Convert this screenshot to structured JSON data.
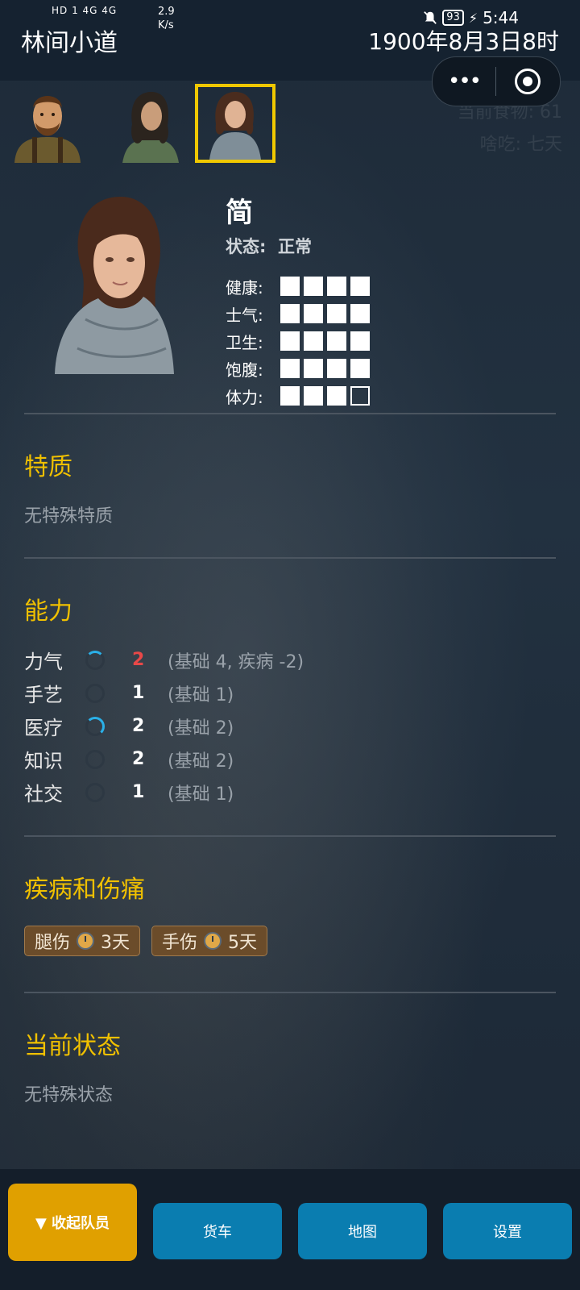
{
  "status_bar": {
    "left_icons": "HD 1  4G  4G",
    "net_speed": "2.9",
    "net_unit": "K/s",
    "battery": "93",
    "clock": "5:44"
  },
  "header": {
    "title": "林间小道",
    "game_time": "1900年8月3日8时"
  },
  "faded_background_text": {
    "food": "当前食物: 61",
    "eat": "啥吃: 七天"
  },
  "party": {
    "members": [
      {
        "name": "bearded-man"
      },
      {
        "name": "dark-haired-woman"
      },
      {
        "name": "jane",
        "selected": true
      }
    ]
  },
  "character": {
    "name": "简",
    "state_label": "状态:",
    "state_value": "正常",
    "stats": [
      {
        "label": "健康:",
        "filled": 4,
        "total": 4
      },
      {
        "label": "士气:",
        "filled": 4,
        "total": 4
      },
      {
        "label": "卫生:",
        "filled": 4,
        "total": 4
      },
      {
        "label": "饱腹:",
        "filled": 4,
        "total": 4
      },
      {
        "label": "体力:",
        "filled": 3,
        "total": 4
      }
    ]
  },
  "traits": {
    "title": "特质",
    "text": "无特殊特质"
  },
  "abilities": {
    "title": "能力",
    "rows": [
      {
        "name": "力气",
        "value": "2",
        "note": "(基础 4, 疾病 -2)",
        "highlight": true
      },
      {
        "name": "手艺",
        "value": "1",
        "note": "(基础 1)"
      },
      {
        "name": "医疗",
        "value": "2",
        "note": "(基础 2)"
      },
      {
        "name": "知识",
        "value": "2",
        "note": "(基础 2)"
      },
      {
        "name": "社交",
        "value": "1",
        "note": "(基础 1)"
      }
    ]
  },
  "injuries": {
    "title": "疾病和伤痛",
    "items": [
      {
        "name": "腿伤",
        "days": "3天"
      },
      {
        "name": "手伤",
        "days": "5天"
      }
    ]
  },
  "current_status": {
    "title": "当前状态",
    "text": "无特殊状态"
  },
  "footer": {
    "collapse": "▼ 收起队员",
    "truck": "货车",
    "map": "地图",
    "settings": "设置"
  },
  "colors": {
    "accent_yellow": "#f0c000",
    "button_blue": "#0a7db0",
    "button_orange": "#e0a000",
    "danger_red": "#e84848"
  }
}
